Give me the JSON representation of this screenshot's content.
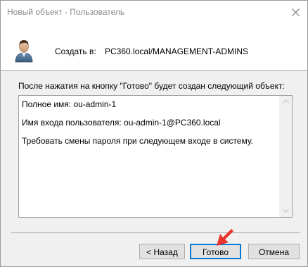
{
  "window": {
    "title": "Новый объект - Пользователь"
  },
  "header": {
    "create_in_label": "Создать в:",
    "create_in_path": "PC360.local/MANAGEMENT-ADMINS",
    "icon": "user-icon"
  },
  "main": {
    "info_text": "После нажатия на кнопку \"Готово\" будет создан следующий объект:",
    "summary_lines": [
      "Полное имя: ou-admin-1",
      "Имя входа пользователя: ou-admin-1@PC360.local",
      "Требовать смены пароля при следующем входе в систему."
    ]
  },
  "buttons": {
    "back": "< Назад",
    "finish": "Готово",
    "cancel": "Отмена"
  },
  "colors": {
    "window_bg": "#f0f0f0",
    "default_button_border": "#0078d7",
    "annotation_arrow": "#e8322a"
  }
}
